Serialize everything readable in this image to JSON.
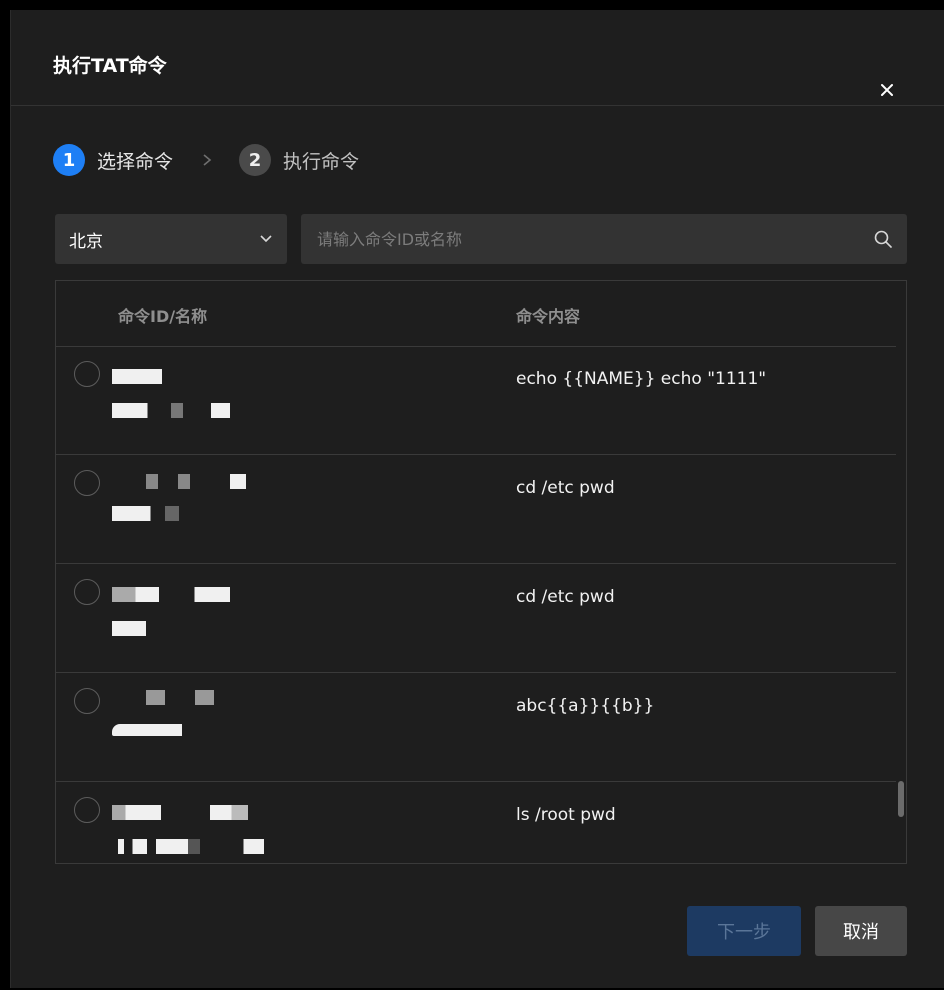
{
  "dialog": {
    "title": "执行TAT命令",
    "close_icon": "close-icon"
  },
  "steps": [
    {
      "num": "1",
      "label": "选择命令",
      "state": "active"
    },
    {
      "num": "2",
      "label": "执行命令",
      "state": "inactive"
    }
  ],
  "filters": {
    "region_value": "北京",
    "search_placeholder": "请输入命令ID或名称",
    "search_value": ""
  },
  "table": {
    "columns": [
      "命令ID/名称",
      "命令内容"
    ],
    "rows": [
      {
        "content": "echo {{NAME}} echo \"1111\"",
        "selected": false
      },
      {
        "content": "cd /etc pwd",
        "selected": false
      },
      {
        "content": "cd /etc pwd",
        "selected": false
      },
      {
        "content": "abc{{a}}{{b}}",
        "selected": false
      },
      {
        "content": "ls /root pwd",
        "selected": false
      }
    ]
  },
  "footer": {
    "next_label": "下一步",
    "cancel_label": "取消"
  },
  "colors": {
    "accent": "#1e7ff5",
    "dialog_bg": "#1e1e1e",
    "input_bg": "#333333"
  }
}
